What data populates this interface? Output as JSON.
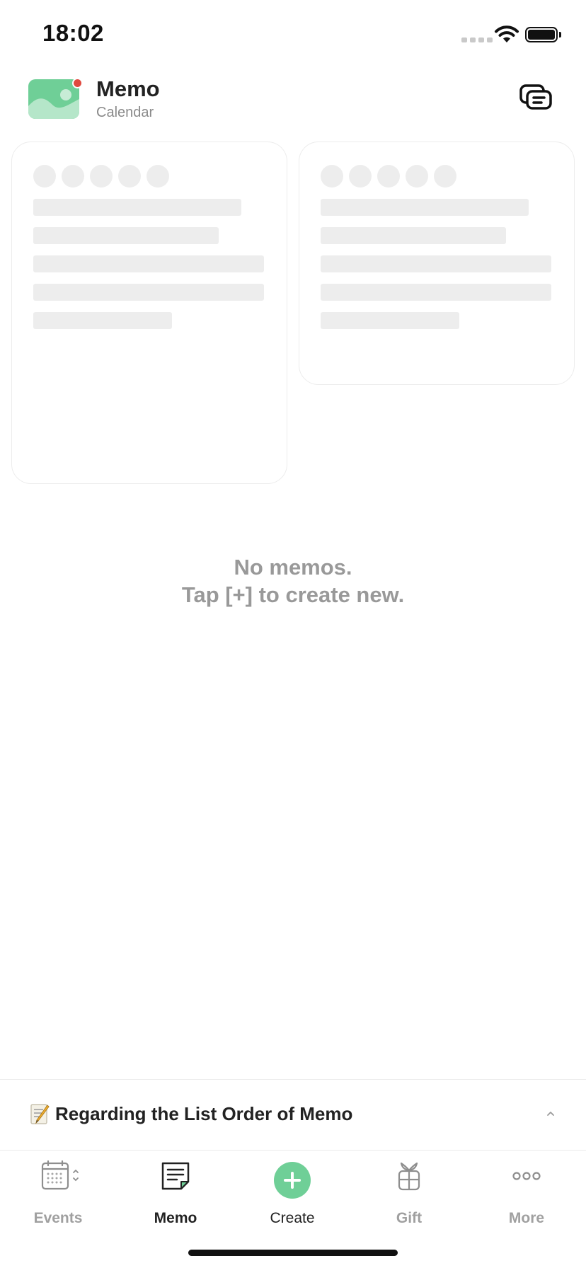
{
  "status_bar": {
    "time": "18:02"
  },
  "header": {
    "title": "Memo",
    "subtitle": "Calendar",
    "chat_icon": "chat-bubbles-icon"
  },
  "empty_state": {
    "line1": "No memos.",
    "line2": "Tap [+] to create new."
  },
  "notice": {
    "emoji_icon": "memo-pencil-icon",
    "text": "Regarding the List Order of Memo",
    "chevron_icon": "chevron-up-icon"
  },
  "tabs": [
    {
      "label": "Events",
      "icon": "calendar-icon",
      "active": false
    },
    {
      "label": "Memo",
      "icon": "memo-icon",
      "active": true
    },
    {
      "label": "Create",
      "icon": "plus-circle-icon",
      "active": false
    },
    {
      "label": "Gift",
      "icon": "gift-icon",
      "active": false
    },
    {
      "label": "More",
      "icon": "more-dots-icon",
      "active": false
    }
  ],
  "colors": {
    "accent_green": "#6fcf97",
    "notification_red": "#e0493e",
    "skeleton_gray": "#ededed",
    "muted_text": "#999999"
  }
}
